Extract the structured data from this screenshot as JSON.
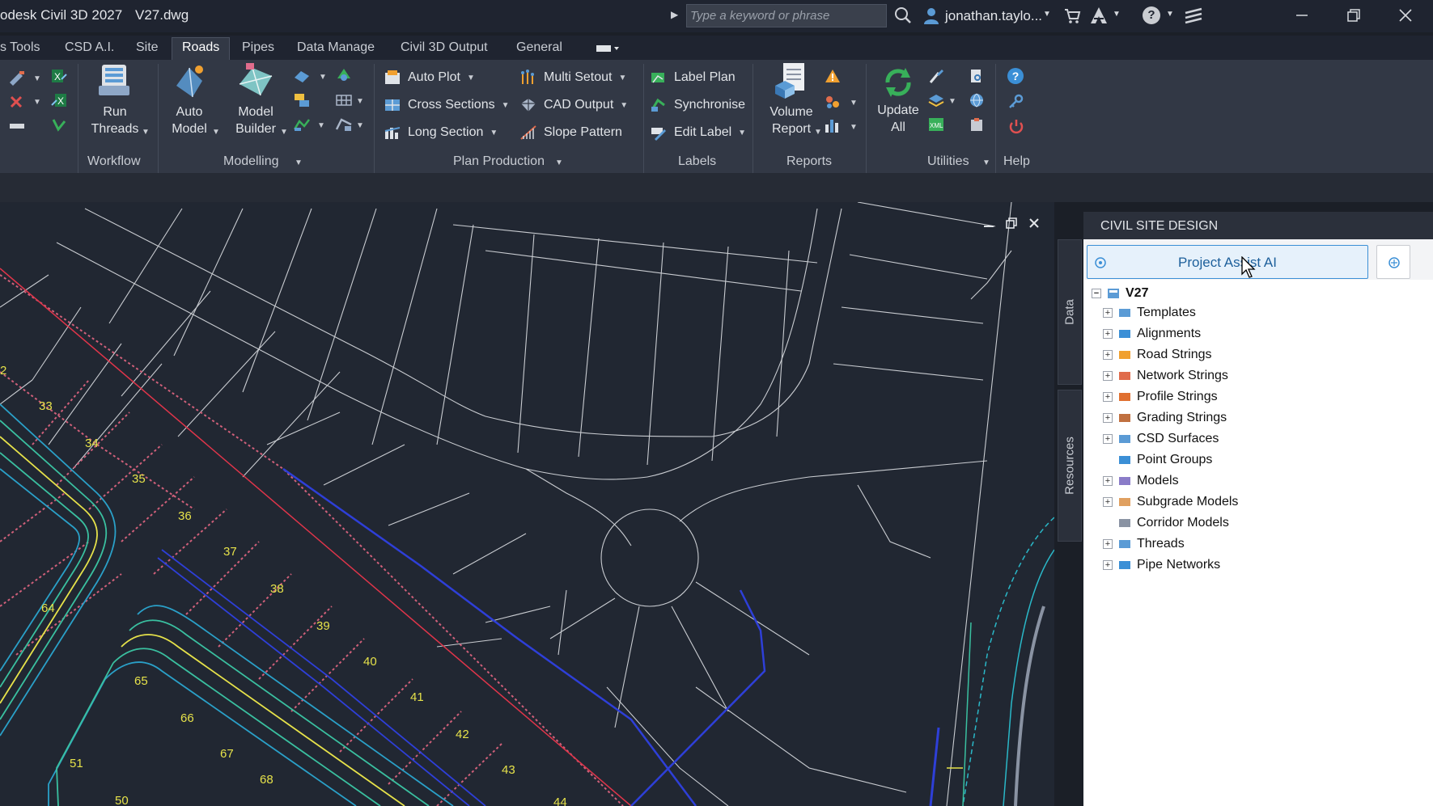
{
  "window": {
    "app_title": "odesk Civil 3D 2027",
    "file_name": "V27.dwg",
    "search_placeholder": "Type a keyword or phrase",
    "user_name": "jonathan.taylo..."
  },
  "menu": {
    "tabs": [
      "s Tools",
      "CSD A.I.",
      "Site",
      "Roads",
      "Pipes",
      "Data Manage",
      "Civil 3D Output",
      "General"
    ],
    "active_tab": "Roads"
  },
  "ribbon": {
    "workflow": {
      "title": "Workflow",
      "run_threads": "Run\nThreads"
    },
    "modelling": {
      "title": "Modelling",
      "auto_model": "Auto\nModel",
      "model_builder": "Model\nBuilder"
    },
    "plan_production": {
      "title": "Plan Production",
      "auto_plot": "Auto  Plot",
      "cross_sections": "Cross Sections",
      "long_section": "Long  Section",
      "multi_setout": "Multi Setout",
      "cad_output": "CAD Output",
      "slope_pattern": "Slope Pattern"
    },
    "labels": {
      "title": "Labels",
      "label_plan": "Label Plan",
      "synchronise": "Synchronise",
      "edit_label": "Edit Label"
    },
    "reports": {
      "title": "Reports",
      "volume_report": "Volume\nReport"
    },
    "utilities": {
      "title": "Utilities",
      "update_all": "Update\nAll"
    },
    "help": {
      "title": "Help"
    }
  },
  "drawing": {
    "lot_numbers": [
      "2",
      "33",
      "34",
      "35",
      "36",
      "37",
      "38",
      "39",
      "40",
      "41",
      "42",
      "43",
      "44",
      "64",
      "65",
      "66",
      "67",
      "68",
      "51",
      "50"
    ]
  },
  "side_tabs": {
    "data": "Data",
    "resources": "Resources"
  },
  "panel": {
    "header": "CIVIL SITE DESIGN",
    "ai_button": "Project Assist AI",
    "tree_root": "V27",
    "tree_items": [
      {
        "label": "Templates",
        "expandable": true,
        "icon": "templates-icon"
      },
      {
        "label": "Alignments",
        "expandable": true,
        "icon": "alignments-icon"
      },
      {
        "label": "Road Strings",
        "expandable": true,
        "icon": "road-strings-icon"
      },
      {
        "label": "Network Strings",
        "expandable": true,
        "icon": "network-strings-icon"
      },
      {
        "label": "Profile Strings",
        "expandable": true,
        "icon": "profile-strings-icon"
      },
      {
        "label": "Grading Strings",
        "expandable": true,
        "icon": "grading-strings-icon"
      },
      {
        "label": "CSD Surfaces",
        "expandable": true,
        "icon": "csd-surfaces-icon"
      },
      {
        "label": "Point Groups",
        "expandable": false,
        "icon": "point-groups-icon"
      },
      {
        "label": "Models",
        "expandable": true,
        "icon": "models-icon"
      },
      {
        "label": "Subgrade Models",
        "expandable": true,
        "icon": "subgrade-models-icon"
      },
      {
        "label": "Corridor Models",
        "expandable": false,
        "icon": "corridor-models-icon"
      },
      {
        "label": "Threads",
        "expandable": true,
        "icon": "threads-icon"
      },
      {
        "label": "Pipe Networks",
        "expandable": true,
        "icon": "pipe-networks-icon"
      }
    ]
  }
}
